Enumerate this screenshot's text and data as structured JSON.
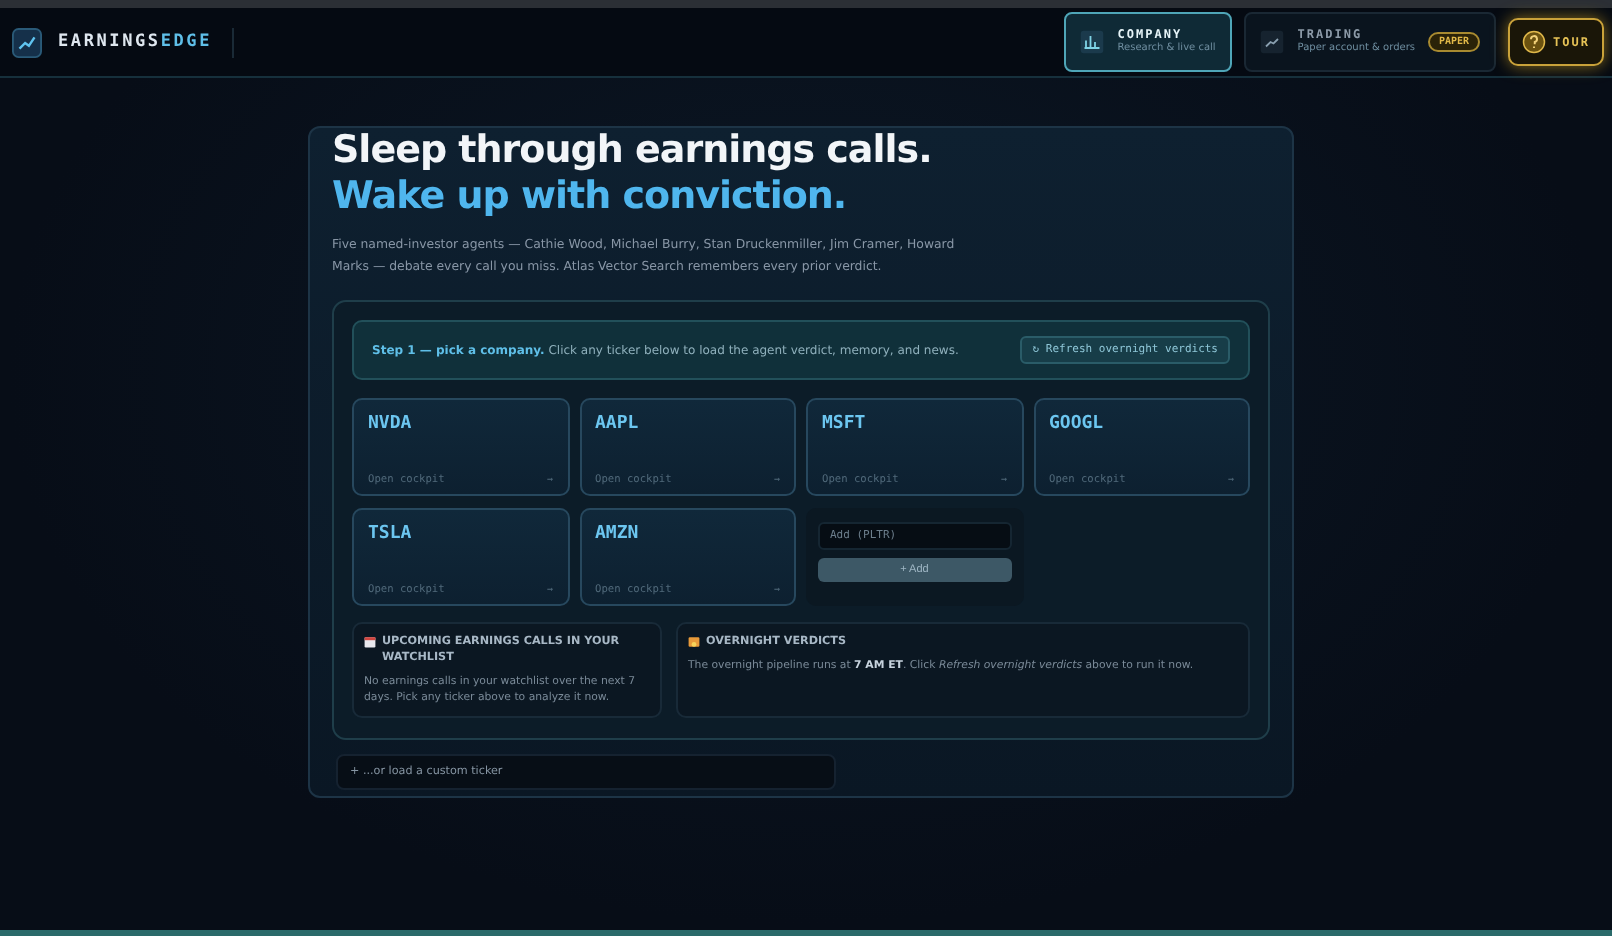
{
  "brand": {
    "part1": "EARNINGS",
    "part2": "EDGE"
  },
  "nav": [
    {
      "kind": "company",
      "title": "COMPANY",
      "subtitle": "Research & live call",
      "selected": true
    },
    {
      "kind": "trading",
      "title": "TRADING",
      "subtitle": "Paper account & orders",
      "badge": "PAPER",
      "selected": false
    }
  ],
  "tour_button": "TOUR",
  "hero": {
    "line1": "Sleep through earnings calls.",
    "line2": "Wake up with conviction.",
    "description": "Five named-investor agents — Cathie Wood, Michael Burry, Stan Druckenmiller, Jim Cramer, Howard Marks — debate every call you miss. Atlas Vector Search remembers every prior verdict."
  },
  "step": {
    "text": "**Step 1 — pick a company.** Click any ticker below to load the agent verdict, memory, and news.",
    "button": "↻ Refresh overnight verdicts"
  },
  "tickers": [
    {
      "symbol": "NVDA",
      "action": "Open cockpit",
      "arrow": "→"
    },
    {
      "symbol": "AAPL",
      "action": "Open cockpit",
      "arrow": "→"
    },
    {
      "symbol": "MSFT",
      "action": "Open cockpit",
      "arrow": "→"
    },
    {
      "symbol": "GOOGL",
      "action": "Open cockpit",
      "arrow": "→"
    },
    {
      "symbol": "TSLA",
      "action": "Open cockpit",
      "arrow": "→"
    },
    {
      "symbol": "AMZN",
      "action": "Open cockpit",
      "arrow": "→"
    }
  ],
  "add": {
    "placeholder": "Add (PLTR)",
    "button": "+ Add"
  },
  "upcoming": {
    "title": "UPCOMING EARNINGS CALLS IN YOUR WATCHLIST",
    "text": "No earnings calls in your watchlist over the next 7 days. Pick any ticker above to analyze it now."
  },
  "overnight": {
    "title": "OVERNIGHT VERDICTS",
    "text": "The overnight pipeline runs at **7 AM ET**. Click *Refresh overnight verdicts* above to run it now."
  },
  "custom_ticker": "+ ...or load a custom ticker"
}
